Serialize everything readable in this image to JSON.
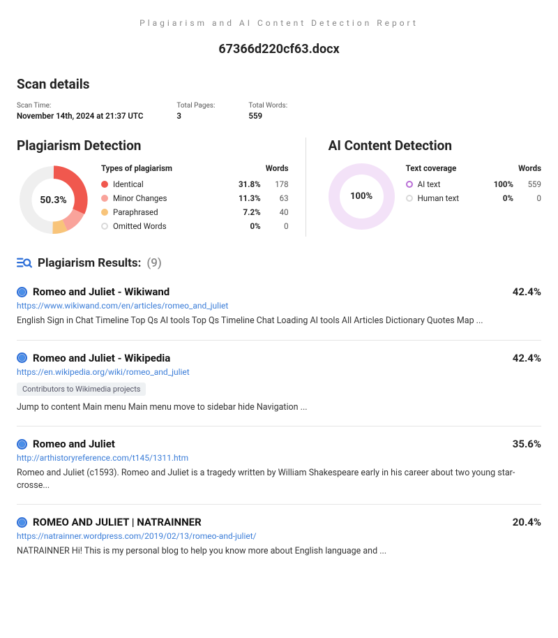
{
  "header": {
    "subtitle": "Plagiarism and AI Content Detection Report",
    "filename": "67366d220cf63.docx"
  },
  "scan_details": {
    "heading": "Scan details",
    "time_label": "Scan Time:",
    "time_value": "November 14th, 2024 at 21:37 UTC",
    "pages_label": "Total Pages:",
    "pages_value": "3",
    "words_label": "Total Words:",
    "words_value": "559"
  },
  "plagiarism": {
    "heading": "Plagiarism Detection",
    "total_pct": "50.3%",
    "types_header": "Types of plagiarism",
    "words_header": "Words",
    "rows": [
      {
        "label": "Identical",
        "pct": "31.8%",
        "words": "178",
        "color": "#f0584e"
      },
      {
        "label": "Minor Changes",
        "pct": "11.3%",
        "words": "63",
        "color": "#f9a39b"
      },
      {
        "label": "Paraphrased",
        "pct": "7.2%",
        "words": "40",
        "color": "#f8c47a"
      },
      {
        "label": "Omitted Words",
        "pct": "0%",
        "words": "0",
        "color": "#e6e6e6"
      }
    ]
  },
  "ai": {
    "heading": "AI Content Detection",
    "total_pct": "100%",
    "coverage_header": "Text coverage",
    "words_header": "Words",
    "rows": [
      {
        "label": "AI text",
        "pct": "100%",
        "words": "559",
        "ring": "#b96fd6"
      },
      {
        "label": "Human text",
        "pct": "0%",
        "words": "0",
        "ring": "#d9d9d9"
      }
    ]
  },
  "results_section": {
    "title": "Plagiarism Results:",
    "count": "(9)"
  },
  "results": [
    {
      "title": "Romeo and Juliet - Wikiwand",
      "pct": "42.4%",
      "url": "https://www.wikiwand.com/en/articles/romeo_and_juliet",
      "badge": "",
      "snippet": "English Sign in Chat Timeline Top Qs AI tools Top Qs Timeline Chat Loading AI tools All Articles Dictionary Quotes Map ..."
    },
    {
      "title": "Romeo and Juliet - Wikipedia",
      "pct": "42.4%",
      "url": "https://en.wikipedia.org/wiki/romeo_and_juliet",
      "badge": "Contributors to Wikimedia projects",
      "snippet": "Jump to content Main menu Main menu move to sidebar hide Navigation ..."
    },
    {
      "title": "Romeo and Juliet",
      "pct": "35.6%",
      "url": "http://arthistoryreference.com/t145/1311.htm",
      "badge": "",
      "snippet": "Romeo and Juliet (c1593). Romeo and Juliet is a tragedy written by William Shakespeare early in his career about two young star-crosse..."
    },
    {
      "title": "ROMEO AND JULIET | NATRAINNER",
      "pct": "20.4%",
      "url": "https://natrainner.wordpress.com/2019/02/13/romeo-and-juliet/",
      "badge": "",
      "snippet": "NATRAINNER Hi! This is my personal blog to help you know more about English language and ..."
    }
  ],
  "chart_data": [
    {
      "type": "pie",
      "title": "Plagiarism Detection breakdown",
      "series": [
        {
          "name": "Identical",
          "value": 31.8
        },
        {
          "name": "Minor Changes",
          "value": 11.3
        },
        {
          "name": "Paraphrased",
          "value": 7.2
        },
        {
          "name": "Non-plagiarised remainder",
          "value": 49.7
        }
      ],
      "center_label": "50.3%"
    },
    {
      "type": "pie",
      "title": "AI Content Detection coverage",
      "series": [
        {
          "name": "AI text",
          "value": 100
        },
        {
          "name": "Human text",
          "value": 0
        }
      ],
      "center_label": "100%"
    }
  ]
}
